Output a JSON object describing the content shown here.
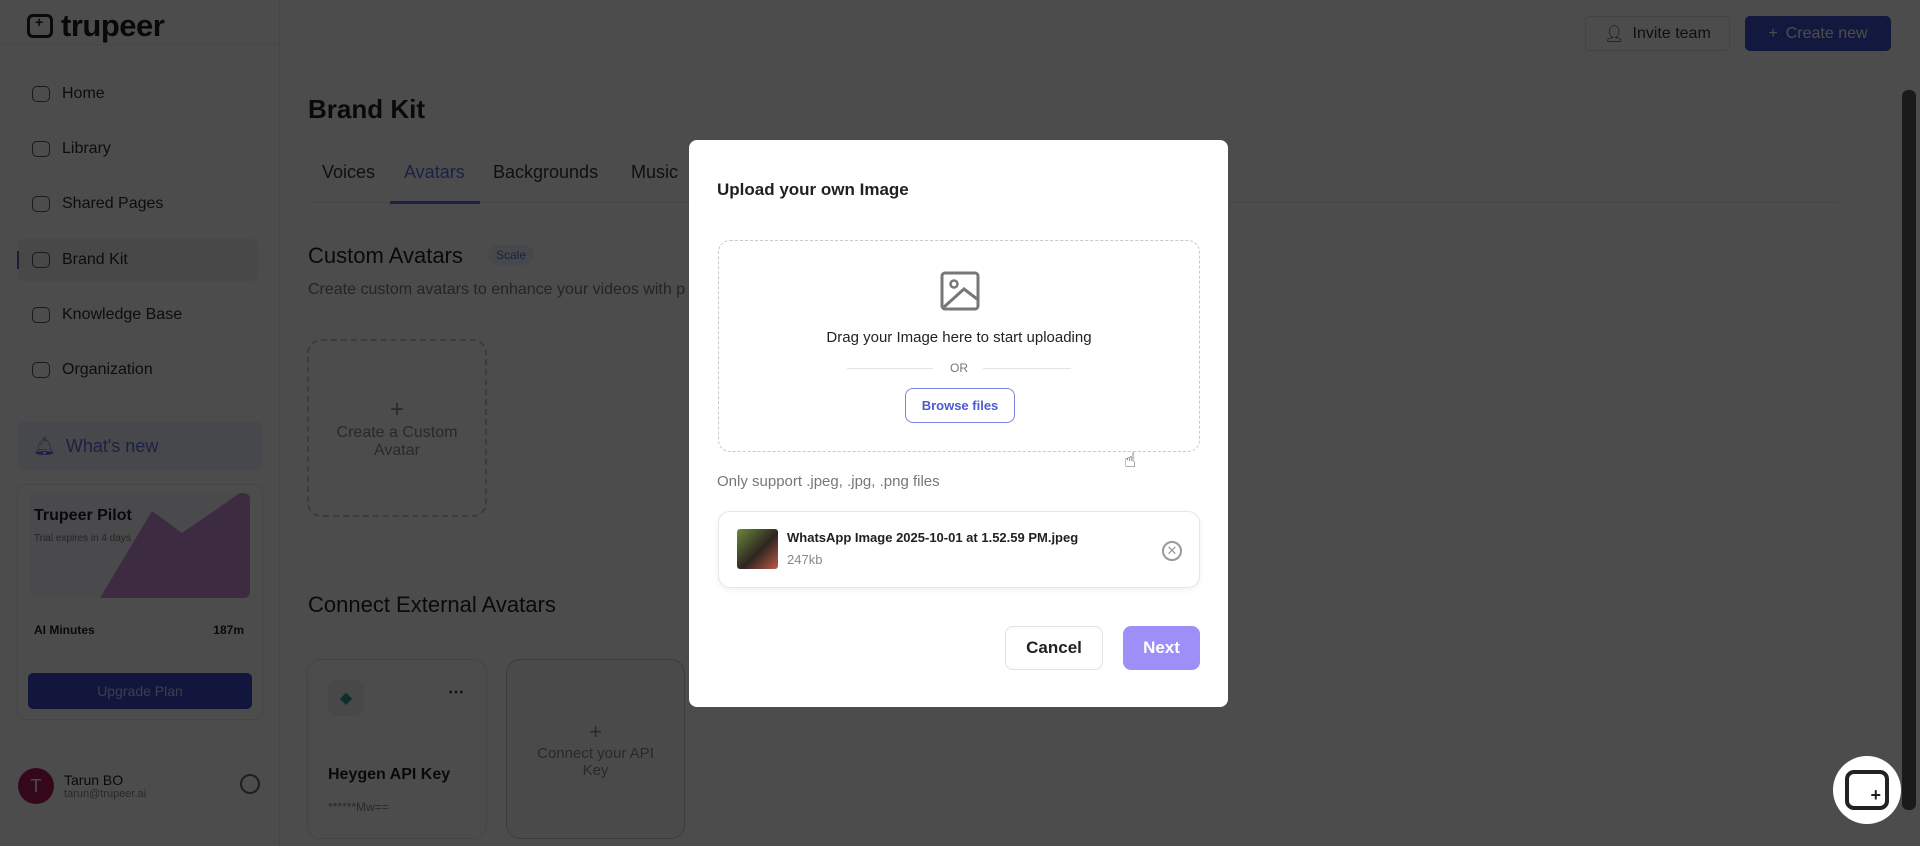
{
  "app": {
    "logo": "trupeer"
  },
  "sidebar": {
    "items": [
      {
        "label": "Home"
      },
      {
        "label": "Library"
      },
      {
        "label": "Shared Pages"
      },
      {
        "label": "Brand Kit"
      },
      {
        "label": "Knowledge Base"
      },
      {
        "label": "Organization"
      }
    ],
    "whats_new": "What's new",
    "plan": {
      "title": "Trupeer Pilot",
      "subtitle": "Trial expires in 4 days",
      "minutes_label": "AI Minutes",
      "minutes_value": "187m",
      "upgrade": "Upgrade Plan"
    },
    "user": {
      "initial": "T",
      "name": "Tarun BO",
      "email": "tarun@trupeer.ai"
    }
  },
  "header": {
    "invite": "Invite team",
    "create": "Create new"
  },
  "main": {
    "title": "Brand Kit",
    "tabs": [
      {
        "label": "Voices"
      },
      {
        "label": "Avatars"
      },
      {
        "label": "Backgrounds"
      },
      {
        "label": "Music"
      }
    ],
    "custom": {
      "title": "Custom Avatars",
      "badge": "Scale",
      "subtitle": "Create custom avatars to enhance your videos with p",
      "create_card": "Create a Custom Avatar"
    },
    "external": {
      "title": "Connect External Avatars",
      "heygen_title": "Heygen API Key",
      "heygen_key": "******Mw==",
      "connect_card": "Connect your API Key"
    }
  },
  "modal": {
    "title": "Upload your own Image",
    "drag_text": "Drag your Image here to start uploading",
    "or": "OR",
    "browse": "Browse files",
    "support": "Only support .jpeg, .jpg, .png files",
    "file": {
      "name": "WhatsApp Image 2025-10-01 at 1.52.59 PM.jpeg",
      "size": "247kb"
    },
    "cancel": "Cancel",
    "next": "Next"
  },
  "colors": {
    "accent": "#5b6ee0",
    "next": "#9c90f8"
  }
}
